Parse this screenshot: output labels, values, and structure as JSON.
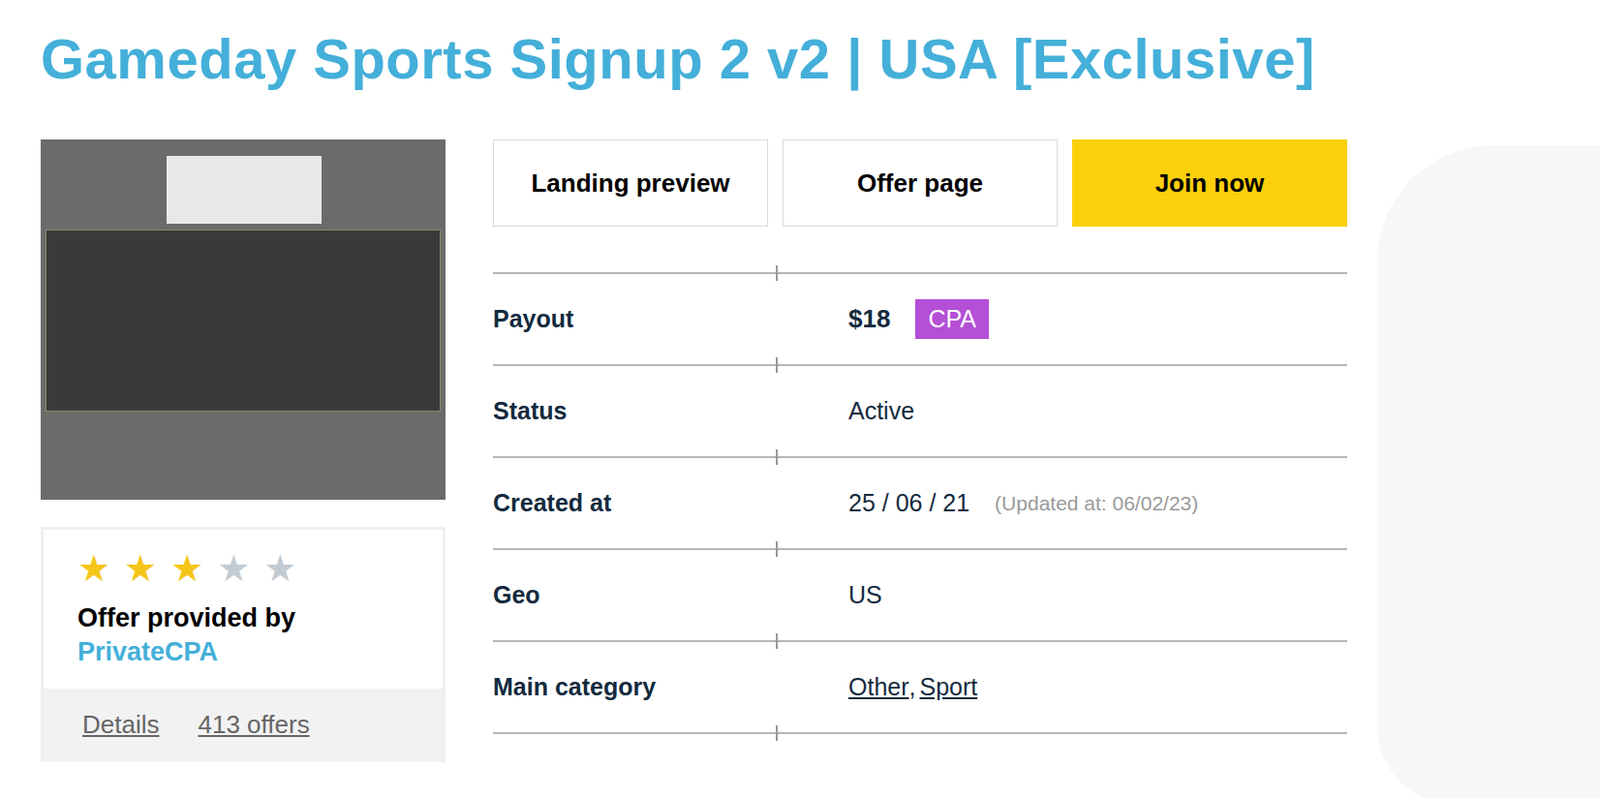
{
  "title": "Gameday Sports Signup 2 v2 | USA [Exclusive]",
  "rating": {
    "stars": 3,
    "max": 5,
    "star_glyph": "★"
  },
  "provider": {
    "label": "Offer provided by",
    "name": "PrivateCPA"
  },
  "provider_links": [
    "Details",
    "413 offers"
  ],
  "buttons": [
    {
      "label": "Landing preview",
      "kind": "outline"
    },
    {
      "label": "Offer page",
      "kind": "outline"
    },
    {
      "label": "Join now",
      "kind": "primary"
    }
  ],
  "rows": [
    {
      "kind": "payout",
      "label": "Payout",
      "value": "$18",
      "badge": "CPA"
    },
    {
      "kind": "plain",
      "label": "Status",
      "value": "Active"
    },
    {
      "kind": "date",
      "label": "Created at",
      "value": "25 / 06 / 21",
      "note": "(Updated at: 06/02/23)"
    },
    {
      "kind": "plain",
      "label": "Geo",
      "value": "US"
    },
    {
      "kind": "links",
      "label": "Main category",
      "links": [
        "Other",
        "Sport"
      ],
      "separator": ","
    }
  ]
}
